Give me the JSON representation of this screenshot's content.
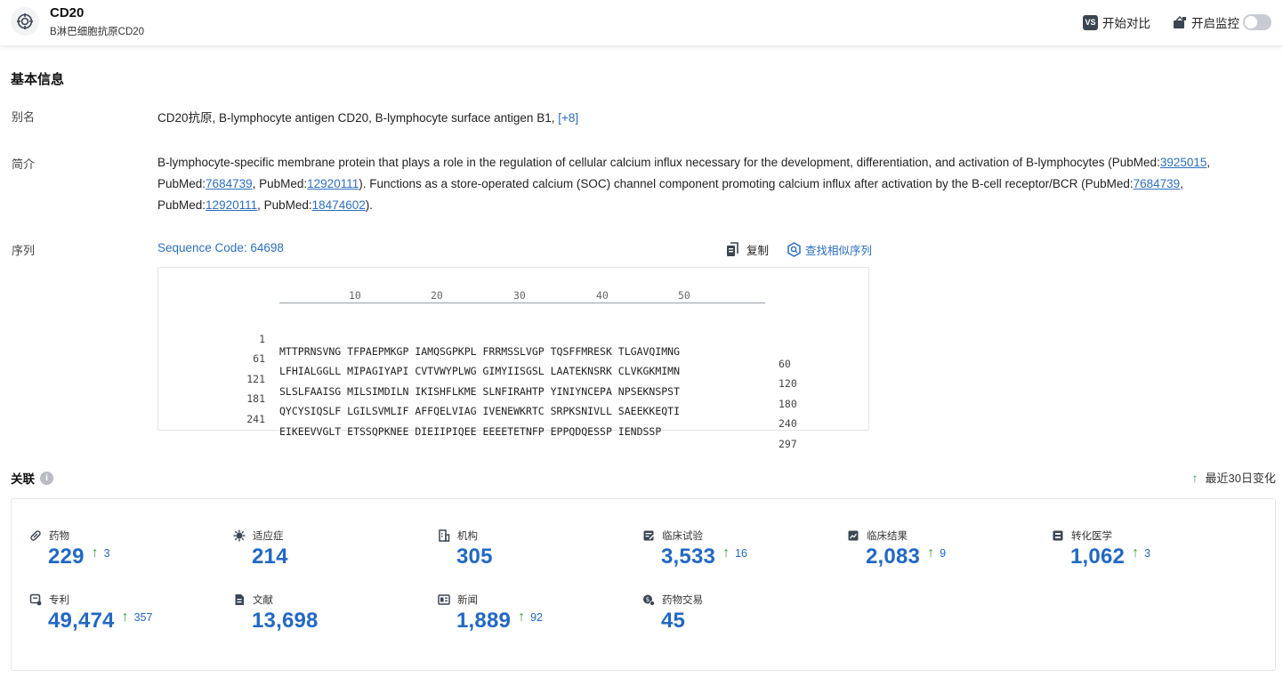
{
  "header": {
    "title": "CD20",
    "subtitle": "B淋巴细胞抗原CD20",
    "compare_badge": "VS",
    "compare_label": "开始对比",
    "monitor_label": "开启监控"
  },
  "basic": {
    "section_title": "基本信息",
    "alias_label": "别名",
    "alias_value": "CD20抗原,  B-lymphocyte antigen CD20,  B-lymphocyte surface antigen B1,",
    "alias_more": "[+8]",
    "summary_label": "简介",
    "summary": {
      "t1": "B-lymphocyte-specific membrane protein that plays a role in the regulation of cellular calcium influx necessary for the development, differentiation, and activation of B-lymphocytes (PubMed:",
      "l1": "3925015",
      "t2": ", PubMed:",
      "l2": "7684739",
      "t3": ", PubMed:",
      "l3": "12920111",
      "t4": "). Functions as a store-operated calcium (SOC) channel component promoting calcium influx after activation by the B-cell receptor/BCR (PubMed:",
      "l4": "7684739",
      "t5": ", PubMed:",
      "l5": "12920111",
      "t6": ", PubMed:",
      "l6": "18474602",
      "t7": ")."
    },
    "sequence_label": "序列",
    "sequence_code": "Sequence Code: 64698",
    "copy_label": "复制",
    "similar_label": "查找相似序列"
  },
  "sequence": {
    "ruler": [
      "10",
      "20",
      "30",
      "40",
      "50"
    ],
    "rows": [
      {
        "start": "1",
        "text": "MTTPRNSVNG TFPAEPMKGP IAMQSGPKPL FRRMSSLVGP TQSFFMRESK TLGAVQIMNG",
        "end": "60"
      },
      {
        "start": "61",
        "text": "LFHIALGGLL MIPAGIYAPI CVTVWYPLWG GIMYIISGSL LAATEKNSRK CLVKGKMIMN",
        "end": "120"
      },
      {
        "start": "121",
        "text": "SLSLFAAISG MILSIMDILN IKISHFLKME SLNFIRAHTP YINIYNCEPA NPSEKNSPST",
        "end": "180"
      },
      {
        "start": "181",
        "text": "QYCYSIQSLF LGILSVMLIF AFFQELVIAG IVENEWKRTC SRPKSNIVLL SAEEKKEQTI",
        "end": "240"
      },
      {
        "start": "241",
        "text": "EIKEEVVGLT ETSSQPKNEE DIEIIPIQEE EEEETETNFP EPPQDQESSP IENDSSP   ",
        "end": "297"
      }
    ]
  },
  "related": {
    "title": "关联",
    "legend": "最近30日变化",
    "stats": [
      {
        "label": "药物",
        "value": "229",
        "delta": "3",
        "icon": "pill-icon"
      },
      {
        "label": "适应症",
        "value": "214",
        "delta": "",
        "icon": "virus-icon"
      },
      {
        "label": "机构",
        "value": "305",
        "delta": "",
        "icon": "building-icon"
      },
      {
        "label": "临床试验",
        "value": "3,533",
        "delta": "16",
        "icon": "clipboard-icon"
      },
      {
        "label": "临床结果",
        "value": "2,083",
        "delta": "9",
        "icon": "chart-doc-icon"
      },
      {
        "label": "转化医学",
        "value": "1,062",
        "delta": "3",
        "icon": "flask-doc-icon"
      },
      {
        "label": "专利",
        "value": "49,474",
        "delta": "357",
        "icon": "patent-icon"
      },
      {
        "label": "文献",
        "value": "13,698",
        "delta": "",
        "icon": "document-icon"
      },
      {
        "label": "新闻",
        "value": "1,889",
        "delta": "92",
        "icon": "news-icon"
      },
      {
        "label": "药物交易",
        "value": "45",
        "delta": "",
        "icon": "deal-icon"
      }
    ]
  },
  "colors": {
    "accent_blue": "#2268c3",
    "link_blue": "#2d6fbd",
    "up_green": "#3aa03a"
  }
}
